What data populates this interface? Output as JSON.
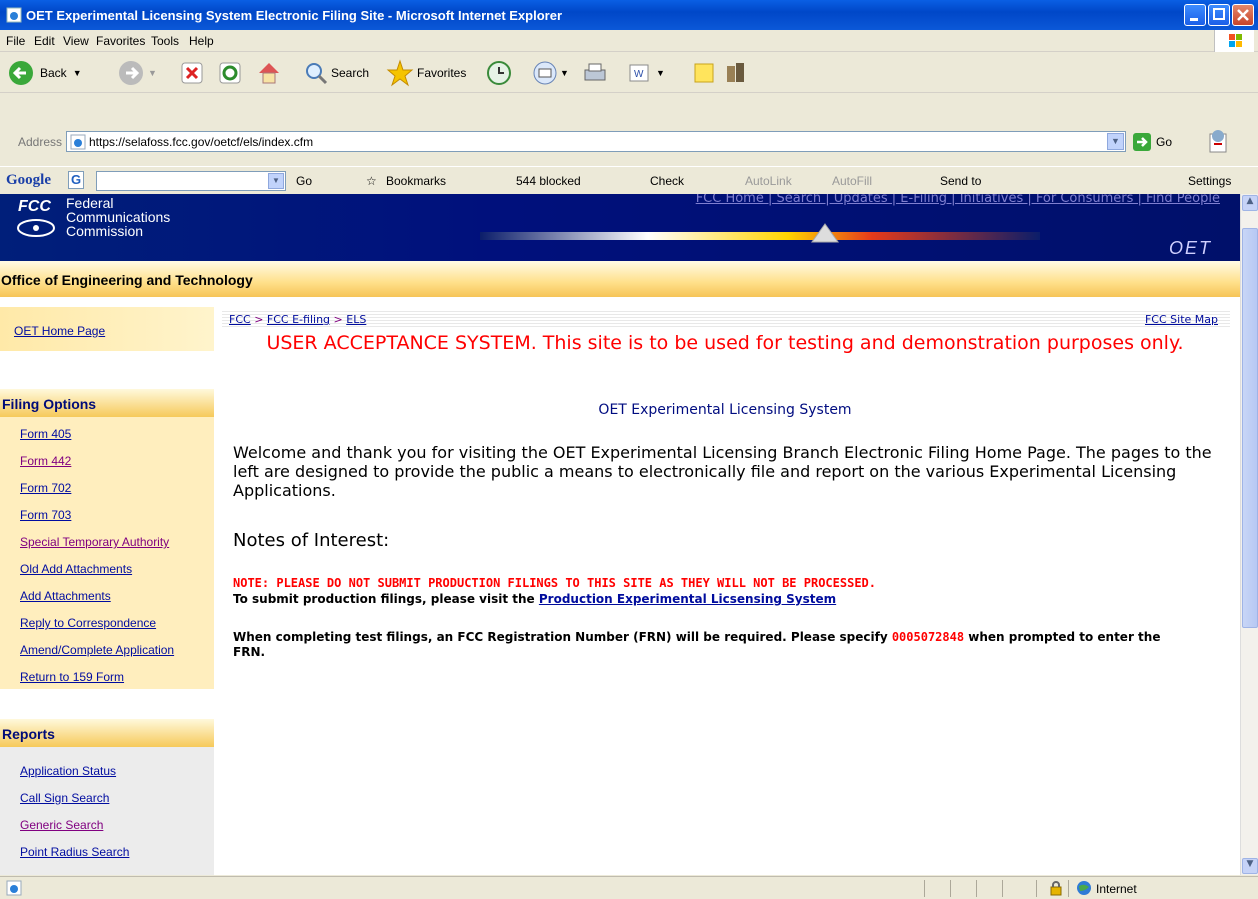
{
  "window": {
    "title": "OET Experimental Licensing System Electronic Filing Site - Microsoft Internet Explorer"
  },
  "menu": [
    "File",
    "Edit",
    "View",
    "Favorites",
    "Tools",
    "Help"
  ],
  "toolbar": {
    "back": "Back",
    "search": "Search",
    "favorites": "Favorites"
  },
  "address": {
    "label": "Address",
    "url": "https://selafoss.fcc.gov/oetcf/els/index.cfm",
    "go": "Go"
  },
  "googlebar": {
    "brand": "Google",
    "go": "Go",
    "bookmarks": "Bookmarks",
    "blocked": "544 blocked",
    "check": "Check",
    "autolink": "AutoLink",
    "autofill": "AutoFill",
    "sendto": "Send to",
    "settings": "Settings"
  },
  "banner": {
    "logo": "FCC",
    "org_line1": "Federal",
    "org_line2": "Communications",
    "org_line3": "Commission",
    "top_links": "FCC Home | Search | Updates | E-Filing | Initiatives | For Consumers | Find People",
    "oet": "OET"
  },
  "oet_bar": "Office of Engineering and Technology",
  "sidebar": {
    "home": "OET Home Page",
    "filing_title": "Filing Options",
    "filing": [
      "Form 405",
      "Form 442",
      "Form 702",
      "Form 703",
      "Special Temporary Authority",
      "Old Add Attachments",
      "Add Attachments",
      "Reply to Correspondence",
      "Amend/Complete Application",
      "Return to 159 Form"
    ],
    "reports_title": "Reports",
    "reports": [
      "Application Status",
      "Call Sign Search",
      "Generic Search",
      "Point Radius Search"
    ]
  },
  "breadcrumb": {
    "a": "FCC",
    "sep": " > ",
    "b": "FCC E-filing",
    "c": "ELS"
  },
  "sitemap": "FCC Site Map",
  "uas": "USER ACCEPTANCE SYSTEM. This site is to be used for testing and demonstration purposes only.",
  "system_name": "OET Experimental Licensing System",
  "welcome": "Welcome and thank you for visiting the OET Experimental Licensing Branch Electronic Filing Home Page. The pages to the left are designed to provide the public a means to electronically file and report on the various Experimental Licensing Applications.",
  "notes_title": "Notes of Interest:",
  "note1": "NOTE: PLEASE DO NOT SUBMIT PRODUCTION FILINGS TO THIS SITE AS THEY WILL NOT BE PROCESSED.",
  "note2_text": "To submit production filings, please visit the ",
  "note2_link": "Production Experimental Licsensing System",
  "note3_a": "When completing test filings, an FCC Registration Number (FRN) will be required. Please specify ",
  "note3_frn": "0005072848",
  "note3_b": " when prompted to enter the FRN.",
  "status": {
    "zone": "Internet"
  }
}
